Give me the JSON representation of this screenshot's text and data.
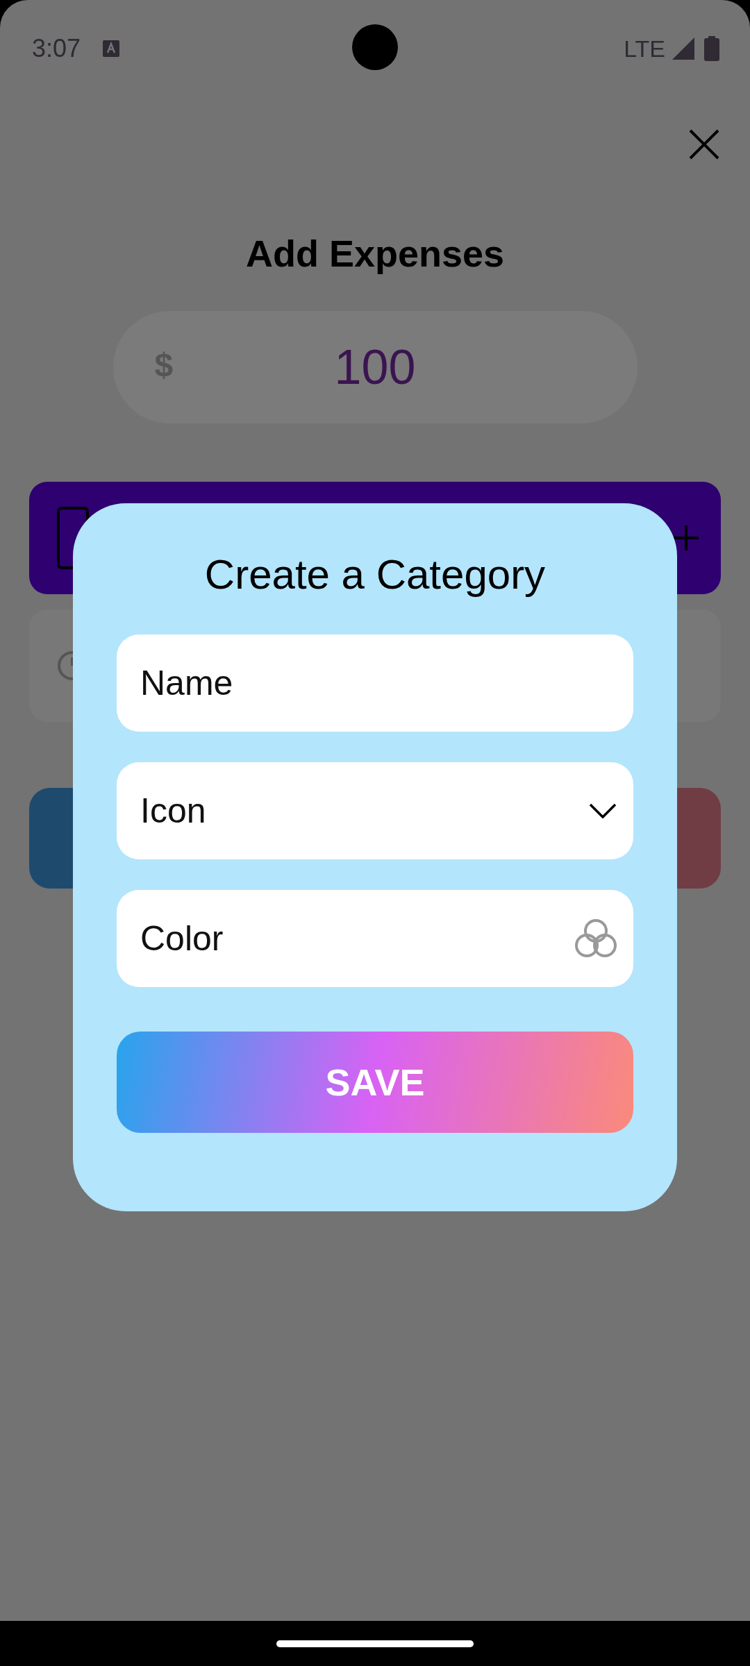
{
  "status_bar": {
    "time": "3:07",
    "network": "LTE"
  },
  "screen": {
    "title": "Add Expenses",
    "amount": {
      "currency": "$",
      "value": "100"
    }
  },
  "dialog": {
    "title": "Create a Category",
    "fields": [
      {
        "kind": "text",
        "placeholder": "Name"
      },
      {
        "kind": "dropdown",
        "placeholder": "Icon"
      },
      {
        "kind": "color",
        "placeholder": "Color"
      }
    ],
    "button": "SAVE"
  }
}
